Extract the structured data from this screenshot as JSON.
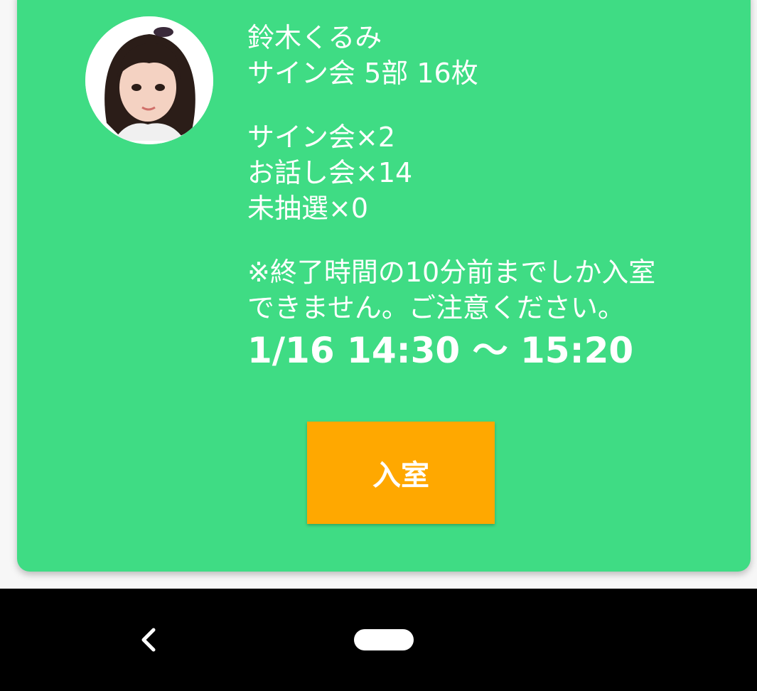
{
  "member": {
    "name": "鈴木くるみ",
    "session": "サイン会 5部 16枚",
    "avatar_icon": "member-photo"
  },
  "tickets": [
    "サイン会×2",
    "お話し会×14",
    "未抽選×0"
  ],
  "notice": [
    "※終了時間の10分前までしか入室",
    "できません。ご注意ください。"
  ],
  "time_range": "1/16 14:30 〜 15:20",
  "enter_button": {
    "label": "入室"
  },
  "navigation": {
    "back_icon": "chevron-left-icon",
    "home_icon": "home-pill-icon"
  },
  "colors": {
    "card": "#3fdc84",
    "button": "#ffa800",
    "navbar": "#000000",
    "text": "#ffffff"
  }
}
